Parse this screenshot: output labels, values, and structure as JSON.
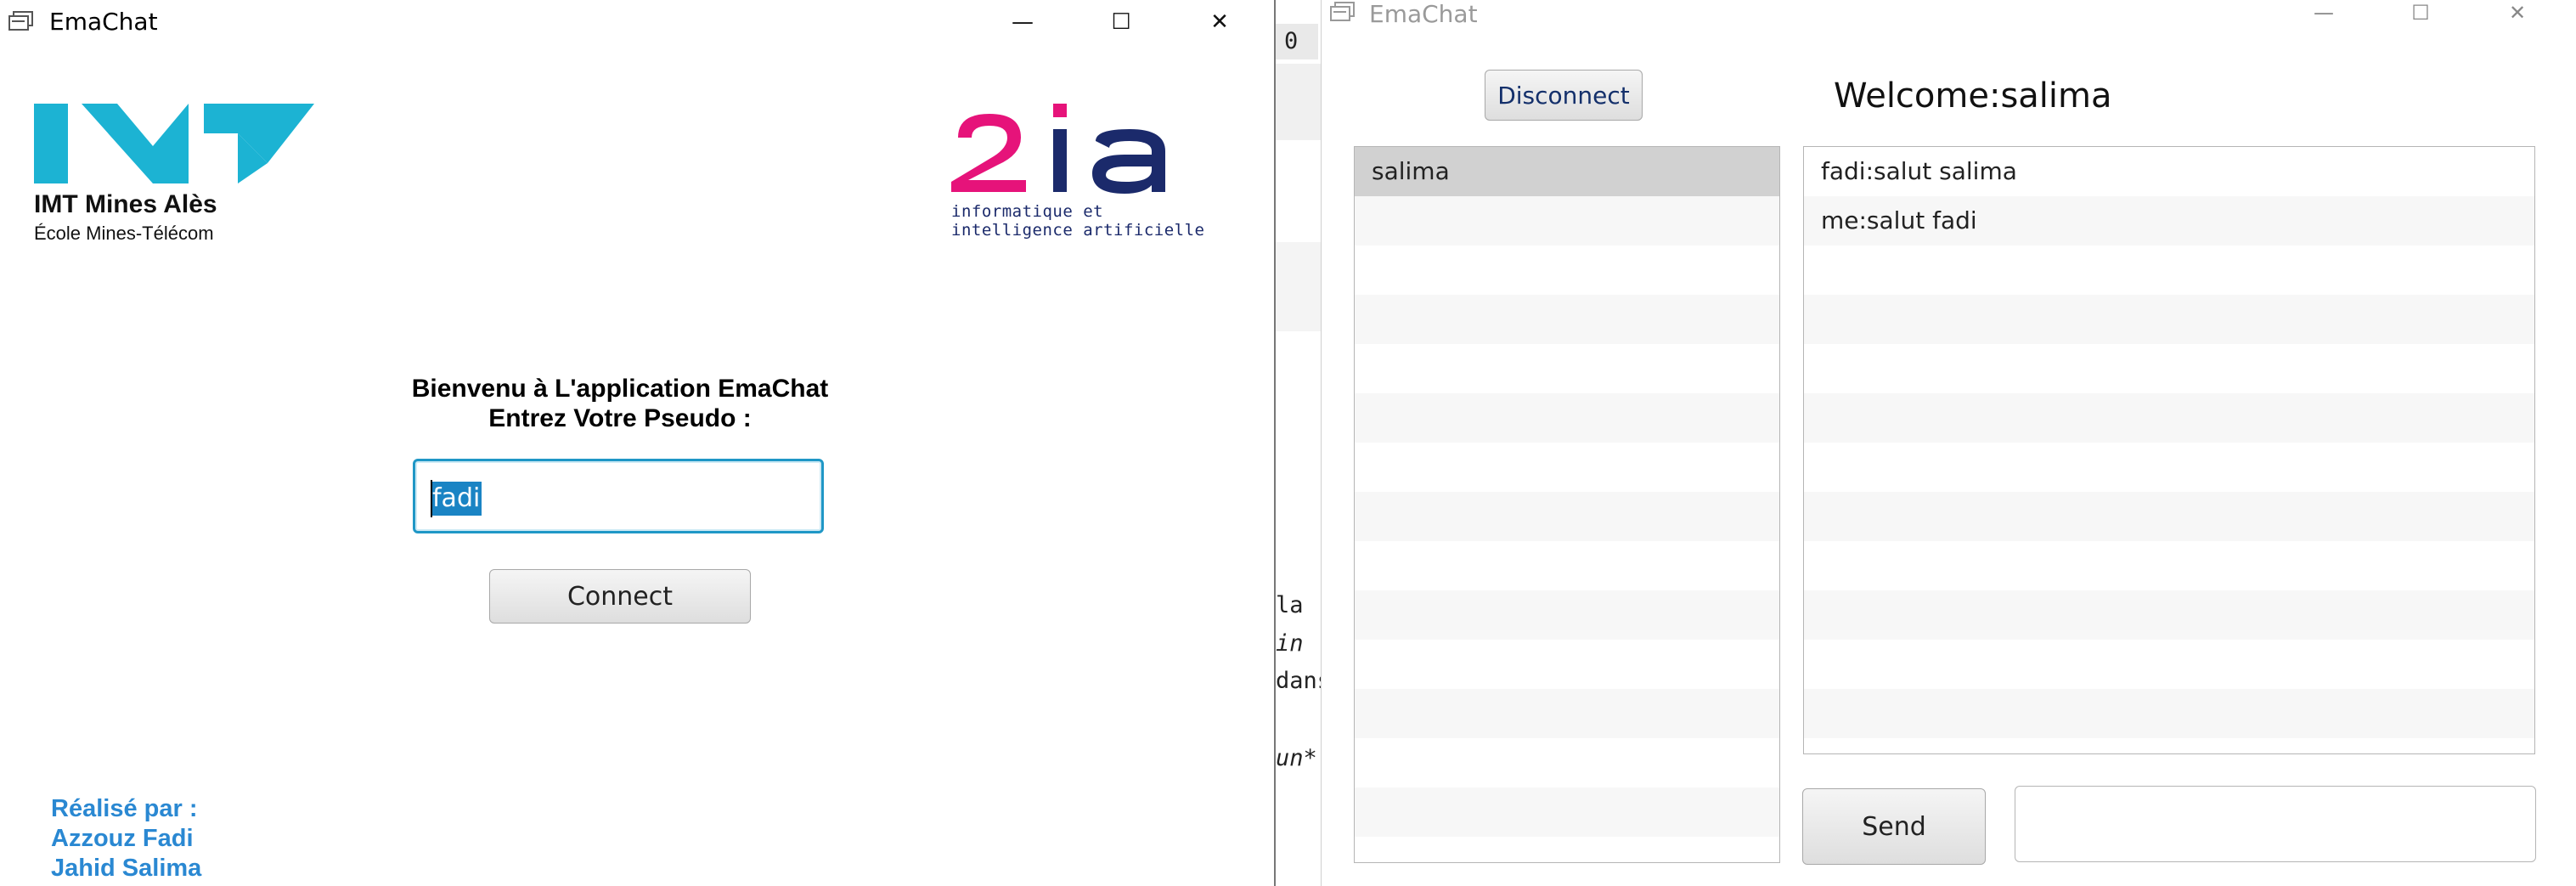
{
  "login_window": {
    "title": "EmaChat",
    "controls": {
      "minimize": "—",
      "maximize": "☐",
      "close": "✕"
    },
    "logo_imt": {
      "name": "IMT Mines Alès",
      "subtitle": "École Mines-Télécom",
      "color": "#1cb3d3"
    },
    "logo_2ia": {
      "big": "2ia",
      "line1": "informatique et",
      "line2": "intelligence artificielle",
      "pink": "#e6137a",
      "navy": "#1b2a6b"
    },
    "welcome_line1": "Bienvenu à L'application EmaChat",
    "welcome_line2": "Entrez Votre Pseudo :",
    "pseudo_value": "fadi",
    "connect_label": "Connect",
    "credits": {
      "line1": "Réalisé par :",
      "line2": "Azzouz Fadi",
      "line3": "Jahid Salima"
    }
  },
  "editor_background": {
    "tab_text": "0",
    "lines": [
      "la",
      "in",
      "dans",
      "un*"
    ]
  },
  "chat_window": {
    "title": "EmaChat",
    "controls": {
      "minimize": "—",
      "maximize": "☐",
      "close": "✕"
    },
    "disconnect_label": "Disconnect",
    "welcome_text": "Welcome:salima",
    "users": [
      "salima"
    ],
    "messages": [
      "fadi:salut salima",
      "me:salut fadi"
    ],
    "send_label": "Send",
    "message_input_value": ""
  }
}
